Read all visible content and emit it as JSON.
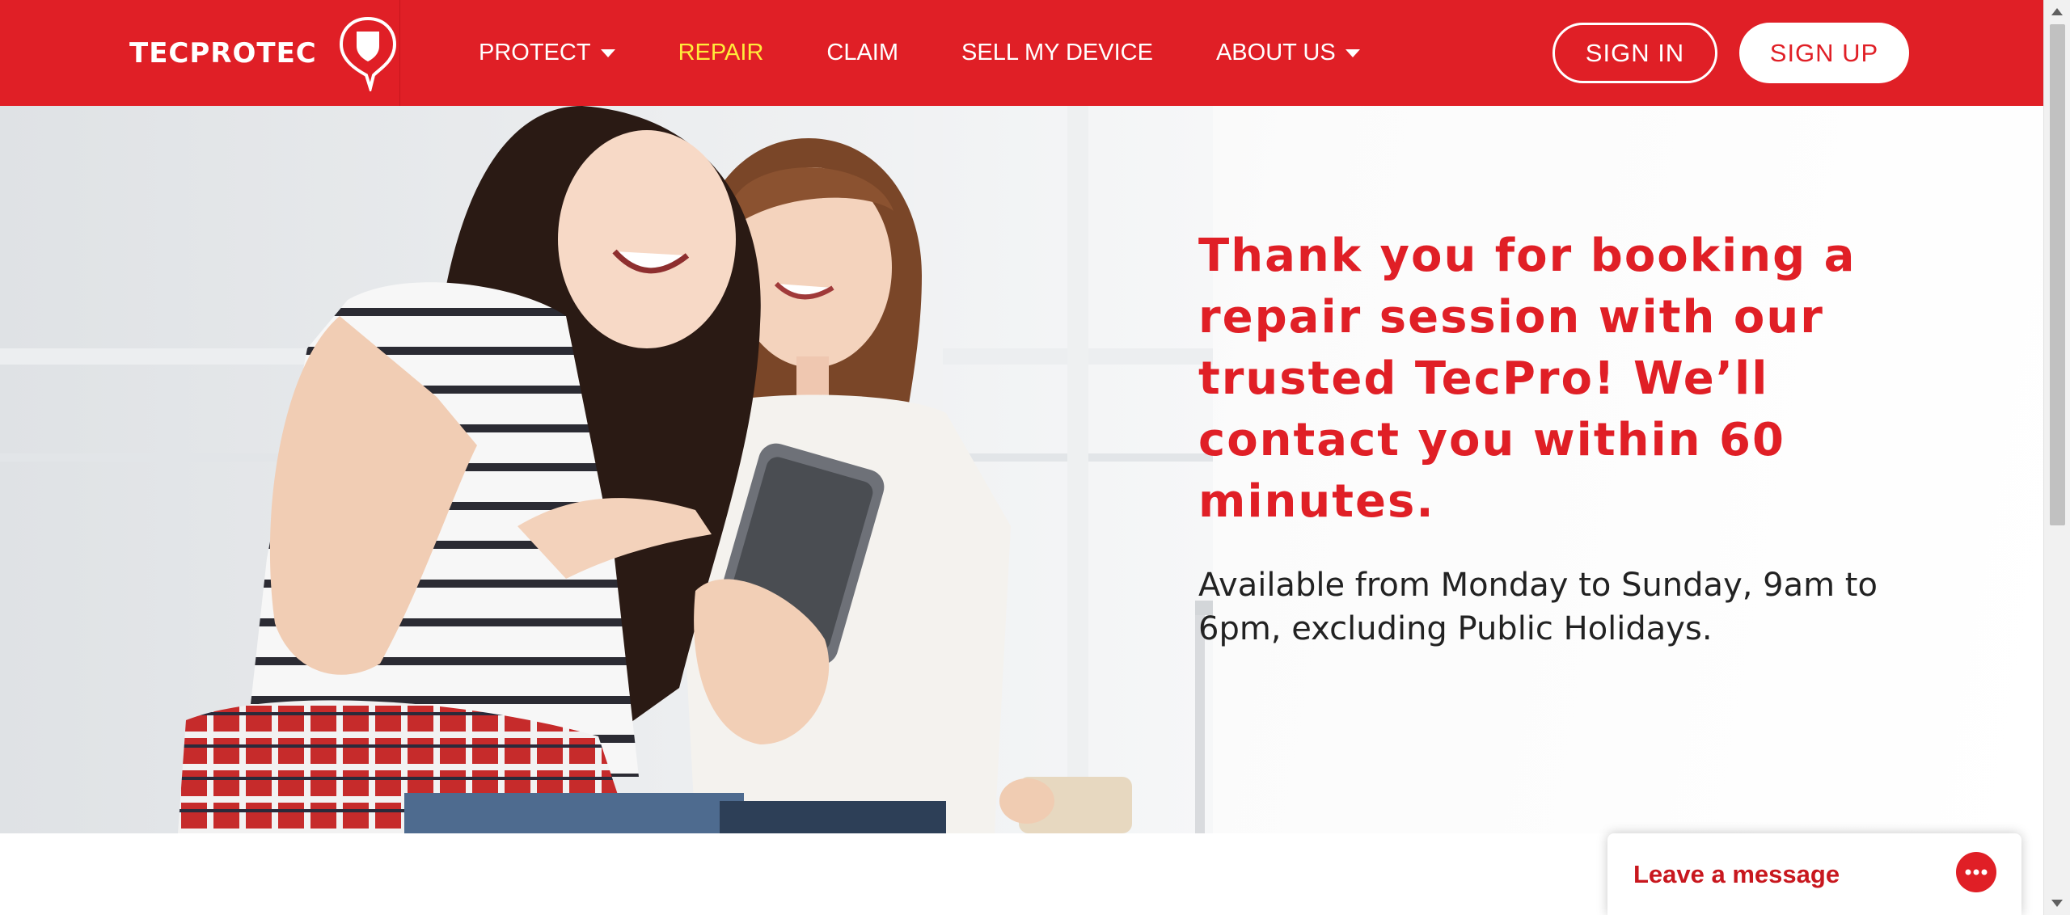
{
  "brand": {
    "name": "TECPROTEC"
  },
  "nav": {
    "items": [
      {
        "label": "PROTECT",
        "has_dropdown": true,
        "active": false
      },
      {
        "label": "REPAIR",
        "has_dropdown": false,
        "active": true
      },
      {
        "label": "CLAIM",
        "has_dropdown": false,
        "active": false
      },
      {
        "label": "SELL MY DEVICE",
        "has_dropdown": false,
        "active": false
      },
      {
        "label": "ABOUT US",
        "has_dropdown": true,
        "active": false
      }
    ]
  },
  "auth": {
    "signin_label": "SIGN IN",
    "signup_label": "SIGN UP"
  },
  "hero": {
    "headline": "Thank you for booking a repair session with our trusted TecPro! We’ll contact you within 60 minutes.",
    "subtext": "Available from Monday to Sunday, 9am to 6pm, excluding Public Holidays."
  },
  "chat": {
    "label": "Leave a message"
  },
  "colors": {
    "brand_red": "#e01f26",
    "active_nav": "#ffeb3b",
    "white": "#ffffff"
  },
  "icons": {
    "logo": "shield-speech-bubble-icon",
    "dropdown": "caret-down-icon",
    "chat": "chat-bubble-icon"
  }
}
